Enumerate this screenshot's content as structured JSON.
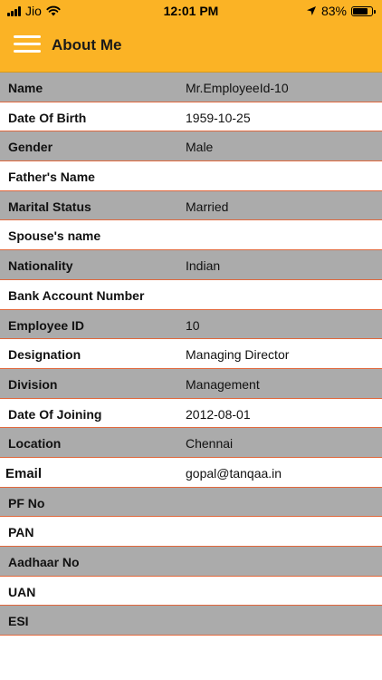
{
  "status_bar": {
    "carrier": "Jio",
    "time": "12:01 PM",
    "battery_percent": "83%",
    "battery_level": 0.83,
    "icons": [
      "signal-icon",
      "wifi-icon",
      "location-arrow-icon",
      "battery-icon"
    ]
  },
  "header": {
    "title": "About Me",
    "menu_icon": "hamburger-menu-icon",
    "background_color": "#fbb325"
  },
  "colors": {
    "row_grey": "#ababab",
    "row_white": "#ffffff",
    "divider": "#e0683d"
  },
  "profile": {
    "rows": [
      {
        "label": "Name",
        "value": "Mr.EmployeeId-10"
      },
      {
        "label": "Date Of Birth",
        "value": "1959-10-25"
      },
      {
        "label": "Gender",
        "value": "Male"
      },
      {
        "label": "Father's Name",
        "value": ""
      },
      {
        "label": "Marital Status",
        "value": "Married"
      },
      {
        "label": "Spouse's name",
        "value": ""
      },
      {
        "label": "Nationality",
        "value": "Indian"
      },
      {
        "label": "Bank Account Number",
        "value": ""
      },
      {
        "label": "Employee ID",
        "value": "10"
      },
      {
        "label": "Designation",
        "value": "Managing Director"
      },
      {
        "label": "Division",
        "value": "Management"
      },
      {
        "label": "Date Of Joining",
        "value": "2012-08-01"
      },
      {
        "label": "Location",
        "value": "Chennai"
      },
      {
        "label": "Email",
        "value": "gopal@tanqaa.in"
      },
      {
        "label": "PF No",
        "value": ""
      },
      {
        "label": "PAN",
        "value": ""
      },
      {
        "label": "Aadhaar No",
        "value": ""
      },
      {
        "label": "UAN",
        "value": ""
      },
      {
        "label": "ESI",
        "value": ""
      }
    ]
  }
}
